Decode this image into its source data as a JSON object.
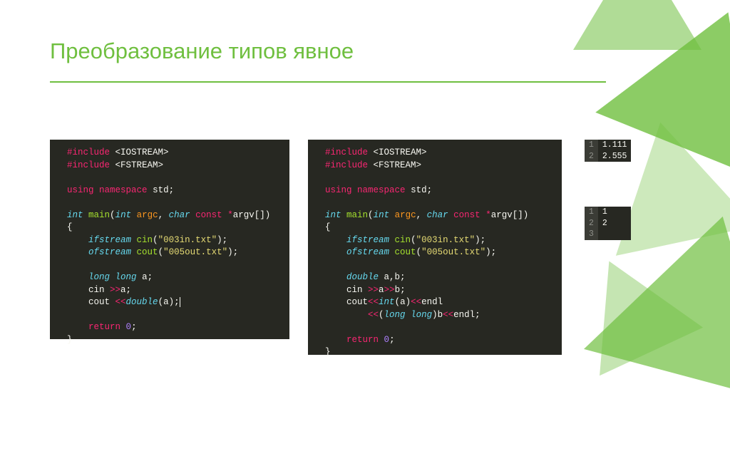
{
  "title": "Преобразование типов явное",
  "code1": {
    "l1_a": "#include",
    "l1_b": "<IOSTREAM>",
    "l2_a": "#include",
    "l2_b": "<FSTREAM>",
    "l3_a": "using",
    "l3_b": "namespace",
    "l3_c": "std",
    "l4_a": "int",
    "l4_b": "main",
    "l4_c": "int",
    "l4_d": "argc",
    "l4_e": "char",
    "l4_f": "const",
    "l4_g": "argv",
    "l5_a": "ifstream",
    "l5_b": "cin",
    "l5_c": "\"003in.txt\"",
    "l6_a": "ofstream",
    "l6_b": "cout",
    "l6_c": "\"005out.txt\"",
    "l7_a": "long",
    "l7_b": "long",
    "l7_c": "a",
    "l8_a": "cin ",
    "l8_b": ">>",
    "l8_c": "a;",
    "l9_a": "cout ",
    "l9_b": "<<",
    "l9_c": "double",
    "l9_d": "(a);",
    "l10_a": "return",
    "l10_b": "0"
  },
  "code2": {
    "l1_a": "#include",
    "l1_b": "<IOSTREAM>",
    "l2_a": "#include",
    "l2_b": "<FSTREAM>",
    "l3_a": "using",
    "l3_b": "namespace",
    "l3_c": "std",
    "l4_a": "int",
    "l4_b": "main",
    "l4_c": "int",
    "l4_d": "argc",
    "l4_e": "char",
    "l4_f": "const",
    "l4_g": "argv",
    "l5_a": "ifstream",
    "l5_b": "cin",
    "l5_c": "\"003in.txt\"",
    "l6_a": "ofstream",
    "l6_b": "cout",
    "l6_c": "\"005out.txt\"",
    "l7_a": "double",
    "l7_b": "a,b;",
    "l8_a": "cin ",
    "l8_b": ">>",
    "l8_c": "a",
    "l8_d": ">>",
    "l8_e": "b;",
    "l9_a": "cout",
    "l9_b": "<<",
    "l9_c": "int",
    "l9_d": "(a)",
    "l9_e": "<<",
    "l9_f": "endl",
    "l10_a": "<<",
    "l10_b": "(",
    "l10_c": "long",
    "l10_d": "long",
    "l10_e": ")b",
    "l10_f": "<<",
    "l10_g": "endl;",
    "l11_a": "return",
    "l11_b": "0"
  },
  "output1": {
    "rows": [
      {
        "ln": "1",
        "val": "1.111"
      },
      {
        "ln": "2",
        "val": "2.555"
      }
    ]
  },
  "output2": {
    "rows": [
      {
        "ln": "1",
        "val": "1"
      },
      {
        "ln": "2",
        "val": "2"
      },
      {
        "ln": "3",
        "val": ""
      }
    ]
  }
}
